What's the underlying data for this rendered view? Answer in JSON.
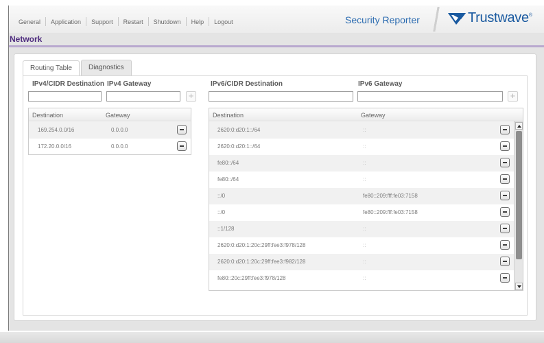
{
  "nav": {
    "items": [
      "General",
      "Application",
      "Support",
      "Restart",
      "Shutdown",
      "Help",
      "Logout"
    ]
  },
  "brand": {
    "product": "Security Reporter",
    "logo_text": "Trustwave",
    "logo_mark": "®",
    "color": "#1a5aa0"
  },
  "page": {
    "title": "Network",
    "title_color": "#4f2d7f"
  },
  "tabs": [
    {
      "label": "Routing Table",
      "active": true
    },
    {
      "label": "Diagnostics",
      "active": false
    }
  ],
  "ipv4": {
    "destination_label": "IPv4/CIDR Destination",
    "gateway_label": "IPv4 Gateway",
    "destination_value": "",
    "gateway_value": "",
    "table": {
      "headers": [
        "Destination",
        "Gateway"
      ],
      "rows": [
        {
          "destination": "169.254.0.0/16",
          "gateway": "0.0.0.0"
        },
        {
          "destination": "172.20.0.0/16",
          "gateway": "0.0.0.0"
        }
      ]
    }
  },
  "ipv6": {
    "destination_label": "IPv6/CIDR Destination",
    "gateway_label": "IPv6 Gateway",
    "destination_value": "",
    "gateway_value": "",
    "table": {
      "headers": [
        "Destination",
        "Gateway"
      ],
      "rows": [
        {
          "destination": "2620:0:d20:1::/64",
          "gateway": "::"
        },
        {
          "destination": "2620:0:d20:1::/64",
          "gateway": "::"
        },
        {
          "destination": "fe80::/64",
          "gateway": "::"
        },
        {
          "destination": "fe80::/64",
          "gateway": "::"
        },
        {
          "destination": "::/0",
          "gateway": "fe80::209:fff:fe03:7158"
        },
        {
          "destination": "::/0",
          "gateway": "fe80::209:fff:fe03:7158"
        },
        {
          "destination": "::1/128",
          "gateway": "::"
        },
        {
          "destination": "2620:0:d20:1:20c:29ff:fee3:f978/128",
          "gateway": "::"
        },
        {
          "destination": "2620:0:d20:1:20c:29ff:fee3:f982/128",
          "gateway": "::"
        },
        {
          "destination": "fe80::20c:29ff:fee3:f978/128",
          "gateway": "::"
        }
      ]
    }
  }
}
